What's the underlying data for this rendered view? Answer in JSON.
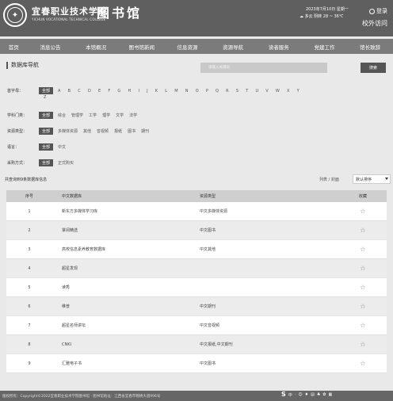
{
  "header": {
    "school_name": "宜春职业技术学院",
    "school_en": "YICHUN VOCATIONAL TECHNICAL COLLEGE",
    "library_title": "图书馆",
    "date": "2023年7月10日 星期一",
    "weather": "多云 阴转 28 ~ 36℃",
    "login_label": "登录",
    "offcampus_label": "校外访问"
  },
  "nav": {
    "items": [
      "首页",
      "消息公告",
      "本馆概况",
      "图书馆新闻",
      "信息资源",
      "资源导航",
      "读者服务",
      "党建工作",
      "馆长致辞"
    ]
  },
  "section": {
    "title": "数据库导航",
    "search_placeholder": "请输入关键词",
    "search_button": "搜索"
  },
  "filters": {
    "first_letter": {
      "label": "首字母：",
      "all": "全部",
      "letters": [
        "A",
        "B",
        "C",
        "D",
        "E",
        "F",
        "G",
        "H",
        "I",
        "J",
        "K",
        "L",
        "M",
        "N",
        "O",
        "P",
        "Q",
        "R",
        "S",
        "T",
        "U",
        "V",
        "W",
        "X",
        "Y"
      ],
      "last": "Z"
    },
    "discipline": {
      "label": "学科门类：",
      "all": "全部",
      "options": [
        "综合",
        "管理学",
        "工学",
        "理学",
        "文学",
        "法学"
      ]
    },
    "resource_type": {
      "label": "资源类型：",
      "all": "全部",
      "options": [
        "多媒体资源",
        "其他",
        "音视频",
        "报纸",
        "图书",
        "期刊"
      ]
    },
    "language": {
      "label": "语言：",
      "all": "全部",
      "options": [
        "中文"
      ]
    },
    "purchase": {
      "label": "采购方式：",
      "all": "全部",
      "options": [
        "正式购买"
      ]
    }
  },
  "results": {
    "summary": "共查询到9条数据库信息",
    "view_toggle": "列表 / 封面",
    "sort_selected": "默认排序"
  },
  "table": {
    "headers": {
      "seq": "序号",
      "name": "中文数据库",
      "type": "资源类型",
      "fav": "收藏"
    },
    "rows": [
      {
        "seq": "1",
        "name": "新东方多媒体学习库",
        "type": "中文多媒体资源"
      },
      {
        "seq": "2",
        "name": "掌阅精选",
        "type": "中文图书"
      },
      {
        "seq": "3",
        "name": "高校信息素养教育数据库",
        "type": "中文其他"
      },
      {
        "seq": "4",
        "name": "超星发现",
        "type": ""
      },
      {
        "seq": "5",
        "name": "读秀",
        "type": ""
      },
      {
        "seq": "6",
        "name": "维普",
        "type": "中文期刊"
      },
      {
        "seq": "7",
        "name": "超星名师讲坛",
        "type": "中文音视频"
      },
      {
        "seq": "8",
        "name": "CNKI",
        "type": "中文报纸,中文期刊"
      },
      {
        "seq": "9",
        "name": "汇雅电子书",
        "type": "中文图书"
      }
    ]
  },
  "footer": {
    "text": "版权所有：Copyright©2022宜春职业技术学院图书馆 · 图书馆地址：江西省宜春市锦绣大道996号",
    "icons": [
      "中",
      "·",
      "☺",
      "♦",
      "▤",
      "♣",
      "✿",
      "▦"
    ]
  }
}
